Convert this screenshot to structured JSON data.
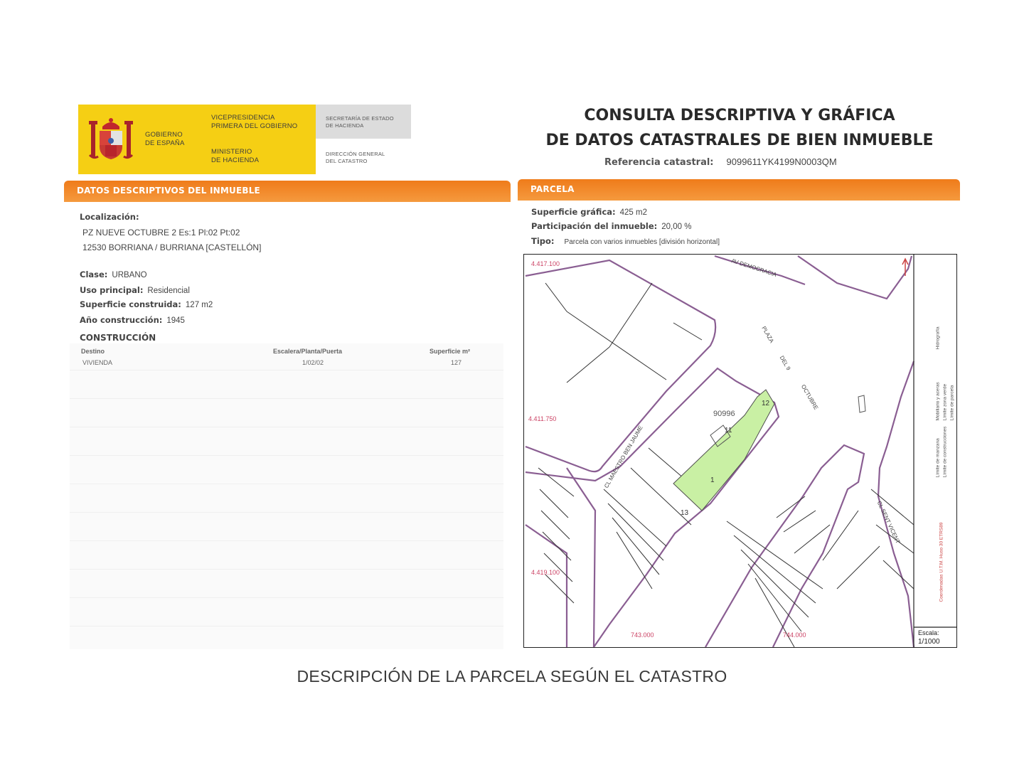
{
  "header": {
    "gov_line1": "GOBIERNO",
    "gov_line2": "DE ESPAÑA",
    "vice_line1": "VICEPRESIDENCIA",
    "vice_line2": "PRIMERA DEL GOBIERNO",
    "min_line1": "MINISTERIO",
    "min_line2": "DE HACIENDA",
    "sec_line1": "SECRETARÍA DE ESTADO",
    "sec_line2": "DE HACIENDA",
    "dir_line1": "DIRECCIÓN GENERAL",
    "dir_line2": "DEL CATASTRO",
    "title_line1": "CONSULTA DESCRIPTIVA Y GRÁFICA",
    "title_line2": "DE DATOS CATASTRALES DE BIEN INMUEBLE",
    "ref_label": "Referencia catastral:",
    "ref_value": "9099611YK4199N0003QM"
  },
  "left": {
    "bar_label": "DATOS DESCRIPTIVOS DEL INMUEBLE",
    "localizacion_label": "Localización:",
    "address_line1": "PZ NUEVE OCTUBRE 2 Es:1 Pl:02 Pt:02",
    "address_line2": "12530 BORRIANA / BURRIANA [CASTELLÓN]",
    "clase_label": "Clase:",
    "clase_value": "URBANO",
    "uso_label": "Uso principal:",
    "uso_value": "Residencial",
    "sup_label": "Superficie construida:",
    "sup_value": "127 m2",
    "anio_label": "Año construcción:",
    "anio_value": "1945",
    "construccion_label": "CONSTRUCCIÓN",
    "table": {
      "headers": [
        "Destino",
        "Escalera/Planta/Puerta",
        "Superficie m²"
      ],
      "rows": [
        [
          "VIVIENDA",
          "1/02/02",
          "127"
        ]
      ]
    }
  },
  "right": {
    "bar_label": "PARCELA",
    "sup_grafica_label": "Superficie gráfica:",
    "sup_grafica_value": "425 m2",
    "participacion_label": "Participación del inmueble:",
    "participacion_value": "20,00 %",
    "tipo_label": "Tipo:",
    "tipo_value": "Parcela con varios inmuebles [división horizontal]"
  },
  "map": {
    "coord_top_left": "4.417.100",
    "coord_mid_left": "4.411.750",
    "coord_low_left": "4.419.100",
    "coord_bottom_1": "743.000",
    "coord_bottom_2": "744.000",
    "street_plaza_1": "PLAZA",
    "street_plaza_2": "DEL 9",
    "street_plaza_3": "OCTUBRE",
    "street_left": "CL MAESTRO BEN JAUME",
    "street_right": "CL SENT VICENT",
    "street_top": "AV DEMOCRACIA",
    "parcel_label": "90996",
    "num_11": "11",
    "num_12": "12",
    "num_13": "13",
    "num_1": "1",
    "legend_1": "Límite de manzana",
    "legend_2": "Límite de parcela",
    "legend_3": "Límite de construcciones",
    "legend_4": "Mobiliario y aceras",
    "legend_5": "Límite zona verde",
    "legend_6": "Hidrografía",
    "legend_note": "Coordenadas U.T.M. Huso 30 ETRS89",
    "scale_label": "Escala:",
    "scale_value": "1/1000"
  },
  "caption": "DESCRIPCIÓN DE LA PARCELA SEGÚN EL CATASTRO"
}
